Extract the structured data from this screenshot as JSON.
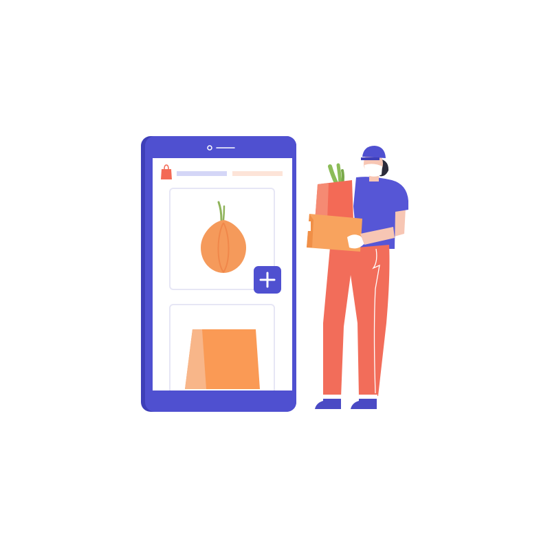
{
  "palette": {
    "phone_body": "#4f50d0",
    "phone_side": "#3e3fb8",
    "screen": "#ffffff",
    "header_bar_primary": "#d4d6f7",
    "header_bar_secondary": "#fde4d8",
    "card_border": "#e6e6f5",
    "onion": "#f59a5b",
    "onion_sprout": "#8fb35a",
    "bag": "#fa9a55",
    "bag_shade": "#f8b689",
    "add_button": "#4f50d0",
    "shirt": "#5656d6",
    "pants": "#f26d5a",
    "skin": "#f7c6b4",
    "hair": "#2b2b3a",
    "box": "#f8a35e",
    "grocery_bag": "#f36a56",
    "greens": "#8cbc58",
    "shoes": "#4a4ac4"
  },
  "icons": {
    "header": "shopping-bag-icon",
    "add": "plus-icon",
    "product_1": "onion-icon",
    "product_2": "paper-bag-icon"
  }
}
